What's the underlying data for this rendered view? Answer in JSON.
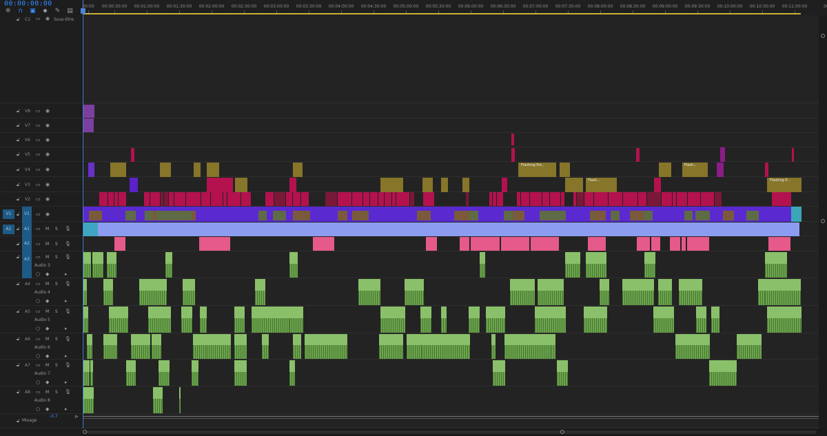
{
  "timecode": "00:00:00:00",
  "toolbar_icons": [
    "snap-icon",
    "linked-selection-icon",
    "add-marker-icon",
    "marker-icon",
    "wrench-icon",
    "captions-icon"
  ],
  "ruler_ticks": [
    "00:00",
    "00:00:30:00",
    "00:01:00:00",
    "00:01:30:00",
    "00:02:00:00",
    "00:02:30:00",
    "00:03:00:00",
    "00:03:30:00",
    "00:04:00:00",
    "00:04:30:00",
    "00:05:00:00",
    "00:05:30:00",
    "00:06:00:00",
    "00:06:30:00",
    "00:07:00:00",
    "00:07:30:00",
    "00:08:00:00",
    "00:08:30:00",
    "00:09:00:00",
    "00:09:30:00",
    "00:10:00:00",
    "00:10:30:00",
    "00:11:00:00",
    "00:"
  ],
  "caption_track": {
    "label": "C1",
    "name": "Sous-titre"
  },
  "video_tracks": [
    "V8",
    "V7",
    "V6",
    "V5",
    "V4",
    "V3",
    "V2",
    "V1"
  ],
  "source_patch": {
    "video": "V1",
    "audio": "A1"
  },
  "audio_tracks": [
    {
      "label": "A1",
      "name": ""
    },
    {
      "label": "A2",
      "name": ""
    },
    {
      "label": "A3",
      "name": "Audio 3"
    },
    {
      "label": "A4",
      "name": "Audio 4"
    },
    {
      "label": "A5",
      "name": "Audio 5"
    },
    {
      "label": "A6",
      "name": "Audio 6"
    },
    {
      "label": "A7",
      "name": "Audio 7"
    },
    {
      "label": "A8",
      "name": "Audio 8"
    }
  ],
  "audio_buttons": {
    "mute": "M",
    "solo": "S"
  },
  "mix": {
    "label": "Mixage",
    "value": "-0.7"
  },
  "clip_labels": {
    "flashing_1": "Flashing Poi...",
    "flashing_2": "Flash...",
    "flashing_3": "Flash...",
    "flashing_4": "Flashing P..."
  },
  "colors": {
    "accent": "#2f8cff",
    "video_v1": "#5a2ad0",
    "video_pink": "#b3124e",
    "video_olive": "#87752a",
    "audio_green": "#8ac06a",
    "audio_pink": "#e55a8a",
    "audio_lavender": "#8c9cf0",
    "audio_cyan": "#3ea6c2",
    "track_target": "#1e5a86"
  }
}
